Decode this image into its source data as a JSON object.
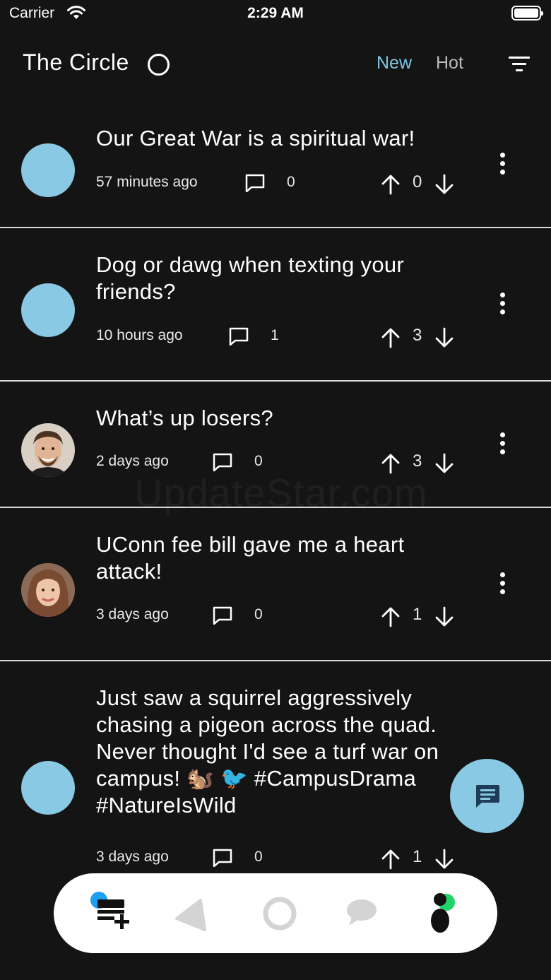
{
  "status_bar": {
    "carrier": "Carrier",
    "time": "2:29 AM"
  },
  "header": {
    "title": "The Circle",
    "tabs": [
      {
        "label": "New",
        "active": true
      },
      {
        "label": "Hot",
        "active": false
      }
    ],
    "icons": {
      "title": "circle-outline-icon",
      "filter": "filter-lines-icon"
    }
  },
  "colors": {
    "accent": "#89c9e3",
    "active_tab": "#7ec5e2",
    "background": "#141414",
    "divider": "#d8d8d8"
  },
  "posts": [
    {
      "title": "Our Great War is a spiritual war!",
      "time": "57 minutes ago",
      "comments": "0",
      "votes": "0",
      "avatar": "default-avatar"
    },
    {
      "title": "Dog or dawg when texting your friends?",
      "time": "10 hours ago",
      "comments": "1",
      "votes": "3",
      "avatar": "default-avatar"
    },
    {
      "title": "What’s up losers?",
      "time": "2 days ago",
      "comments": "0",
      "votes": "3",
      "avatar": "photo-avatar-man"
    },
    {
      "title": "UConn fee bill gave me a heart attack!",
      "time": "3 days ago",
      "comments": "0",
      "votes": "1",
      "avatar": "photo-avatar-woman"
    },
    {
      "title": "Just saw a squirrel aggressively chasing a pigeon across the quad. Never thought I'd see a turf war on campus! 🐿️ 🐦 #CampusDrama #NatureIsWild",
      "time": "3 days ago",
      "comments": "0",
      "votes": "1",
      "avatar": "default-avatar"
    }
  ],
  "watermark": "UpdateStar.com",
  "fab": {
    "icon": "chat-message-icon"
  },
  "bottom_nav": [
    {
      "icon": "new-post-icon",
      "active": true
    },
    {
      "icon": "triangle-icon",
      "active": false
    },
    {
      "icon": "circle-icon",
      "active": false
    },
    {
      "icon": "chat-bubble-icon",
      "active": false
    },
    {
      "icon": "profile-icon",
      "active": false
    }
  ]
}
